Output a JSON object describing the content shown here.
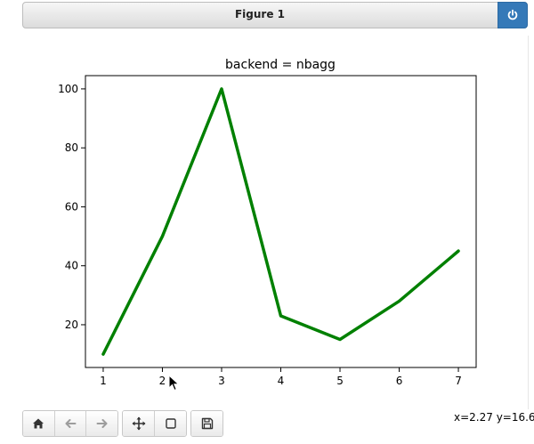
{
  "window": {
    "title": "Figure 1",
    "close_icon": "power-icon",
    "accent_color": "#3579b8"
  },
  "toolbar": {
    "buttons": [
      {
        "name": "home",
        "icon": "home-icon"
      },
      {
        "name": "back",
        "icon": "arrow-left-icon"
      },
      {
        "name": "forward",
        "icon": "arrow-right-icon"
      },
      {
        "name": "pan",
        "icon": "move-icon"
      },
      {
        "name": "zoom",
        "icon": "square-icon"
      },
      {
        "name": "save",
        "icon": "floppy-disk-icon"
      }
    ]
  },
  "status": {
    "coordinates": "x=2.27 y=16.6"
  },
  "chart_data": {
    "type": "line",
    "title": "backend = nbagg",
    "xlabel": "",
    "ylabel": "",
    "x": [
      1,
      2,
      3,
      4,
      5,
      6,
      7
    ],
    "series": [
      {
        "values": [
          10,
          50,
          100,
          23,
          15,
          28,
          45
        ],
        "color": "#008000"
      }
    ],
    "xticks": [
      1,
      2,
      3,
      4,
      5,
      6,
      7
    ],
    "yticks": [
      20,
      40,
      60,
      80,
      100
    ],
    "xlim": [
      0.7,
      7.3
    ],
    "ylim": [
      5.5,
      104.5
    ],
    "grid": false
  }
}
